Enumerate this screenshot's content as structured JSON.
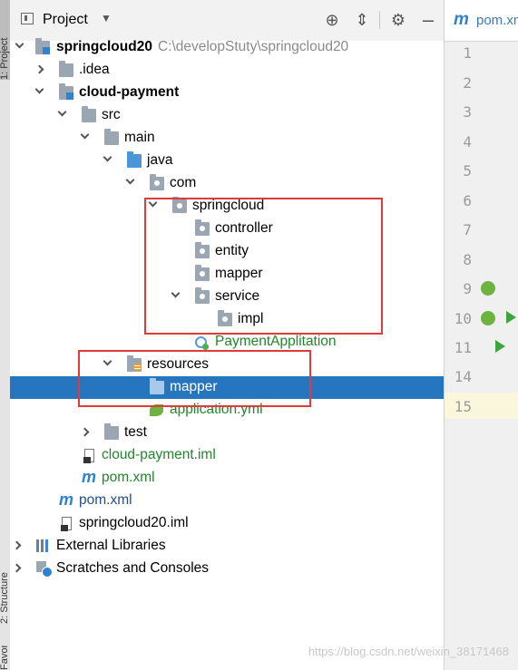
{
  "stripe": {
    "tabs": [
      "1: Project",
      "2: Structure",
      "Favorites"
    ]
  },
  "header": {
    "title": "Project",
    "dropdown_icon": "chevron-down-icon",
    "actions": [
      "locate-icon",
      "collapse-all-icon",
      "gear-icon",
      "minimize-icon"
    ]
  },
  "tree": [
    {
      "label": "springcloud20",
      "path": "C:\\developStuty\\springcloud20",
      "icon": "module-folder-icon",
      "expanded": true
    },
    {
      "label": ".idea",
      "icon": "folder-icon",
      "expanded": false
    },
    {
      "label": "cloud-payment",
      "icon": "module-folder-icon",
      "expanded": true
    },
    {
      "label": "src",
      "icon": "folder-icon",
      "expanded": true
    },
    {
      "label": "main",
      "icon": "folder-icon",
      "expanded": true
    },
    {
      "label": "java",
      "icon": "source-folder-icon",
      "expanded": true
    },
    {
      "label": "com",
      "icon": "package-icon",
      "expanded": true
    },
    {
      "label": "springcloud",
      "icon": "package-icon",
      "expanded": true
    },
    {
      "label": "controller",
      "icon": "package-icon"
    },
    {
      "label": "entity",
      "icon": "package-icon"
    },
    {
      "label": "mapper",
      "icon": "package-icon"
    },
    {
      "label": "service",
      "icon": "package-icon",
      "expanded": true
    },
    {
      "label": "impl",
      "icon": "package-icon"
    },
    {
      "label": "PaymentApplitation",
      "icon": "spring-boot-class-icon"
    },
    {
      "label": "resources",
      "icon": "resources-folder-icon",
      "expanded": true
    },
    {
      "label": "mapper",
      "icon": "folder-icon",
      "selected": true
    },
    {
      "label": "application.yml",
      "icon": "spring-yml-icon"
    },
    {
      "label": "test",
      "icon": "folder-icon",
      "expanded": false
    },
    {
      "label": "cloud-payment.iml",
      "icon": "iml-file-icon"
    },
    {
      "label": "pom.xml",
      "icon": "maven-icon"
    },
    {
      "label": "pom.xml",
      "icon": "maven-icon"
    },
    {
      "label": "springcloud20.iml",
      "icon": "iml-file-icon"
    },
    {
      "label": "External Libraries",
      "icon": "libraries-icon",
      "expanded": false
    },
    {
      "label": "Scratches and Consoles",
      "icon": "scratches-icon",
      "expanded": false
    }
  ],
  "editor": {
    "tab_label": "pom.xml",
    "tab_icon": "maven-icon",
    "line_numbers": [
      "1",
      "2",
      "3",
      "4",
      "5",
      "6",
      "7",
      "8",
      "9",
      "10",
      "11",
      "14",
      "15"
    ],
    "current_line": "15"
  },
  "watermark": "https://blog.csdn.net/weixin_38171468",
  "colors": {
    "selection": "#2675bf",
    "annotation_red": "#e03b3b",
    "spring_green": "#22862b",
    "maven_blue": "#2e82d0"
  }
}
